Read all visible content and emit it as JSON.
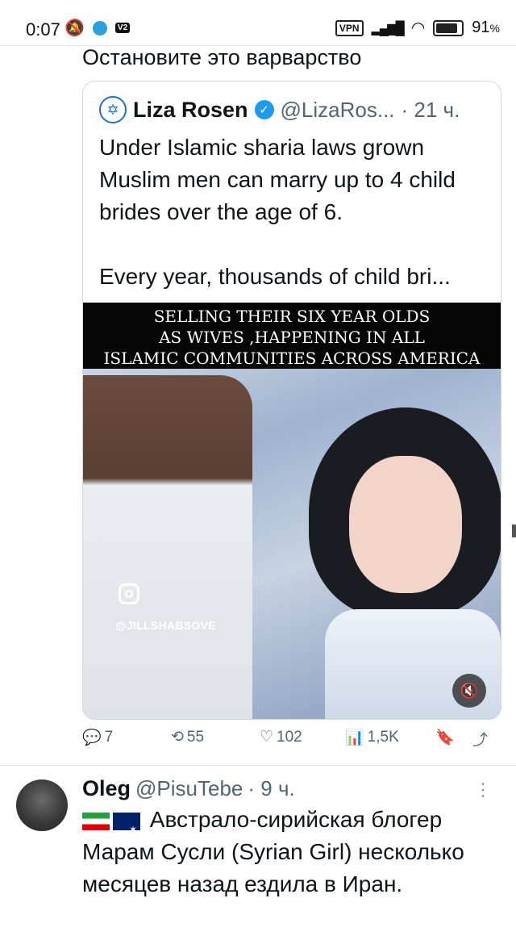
{
  "status_bar": {
    "time": "0:07",
    "battery": "91",
    "battery_unit": "%",
    "vpn": "VPN",
    "v2": "V2"
  },
  "tweet": {
    "text": "Остановите это варварство"
  },
  "quote": {
    "name": "Liza Rosen",
    "handle": "@LizaRos...",
    "time": "· 21 ч.",
    "paragraphs": [
      "Under Islamic sharia laws grown Muslim men can marry up to 4 child brides over the age of 6.",
      "Every year, thousands of child bri..."
    ],
    "video": {
      "banner_lines": [
        "SELLING THEIR SIX YEAR OLDS",
        "AS WIVES ,HAPPENING IN ALL",
        "ISLAMIC COMMUNITIES ACROSS AMERICA"
      ],
      "watermark": "@JILLSHABSOVE"
    }
  },
  "actions": {
    "replies": "7",
    "retweets": "55",
    "likes": "102",
    "views": "1,5K"
  },
  "reply": {
    "name": "Oleg",
    "handle": "@PisuTebe",
    "time": "· 9 ч.",
    "text": "Австрало-сирийская блогер Марам Сусли (Syrian Girl) несколько месяцев назад ездила в Иран."
  }
}
